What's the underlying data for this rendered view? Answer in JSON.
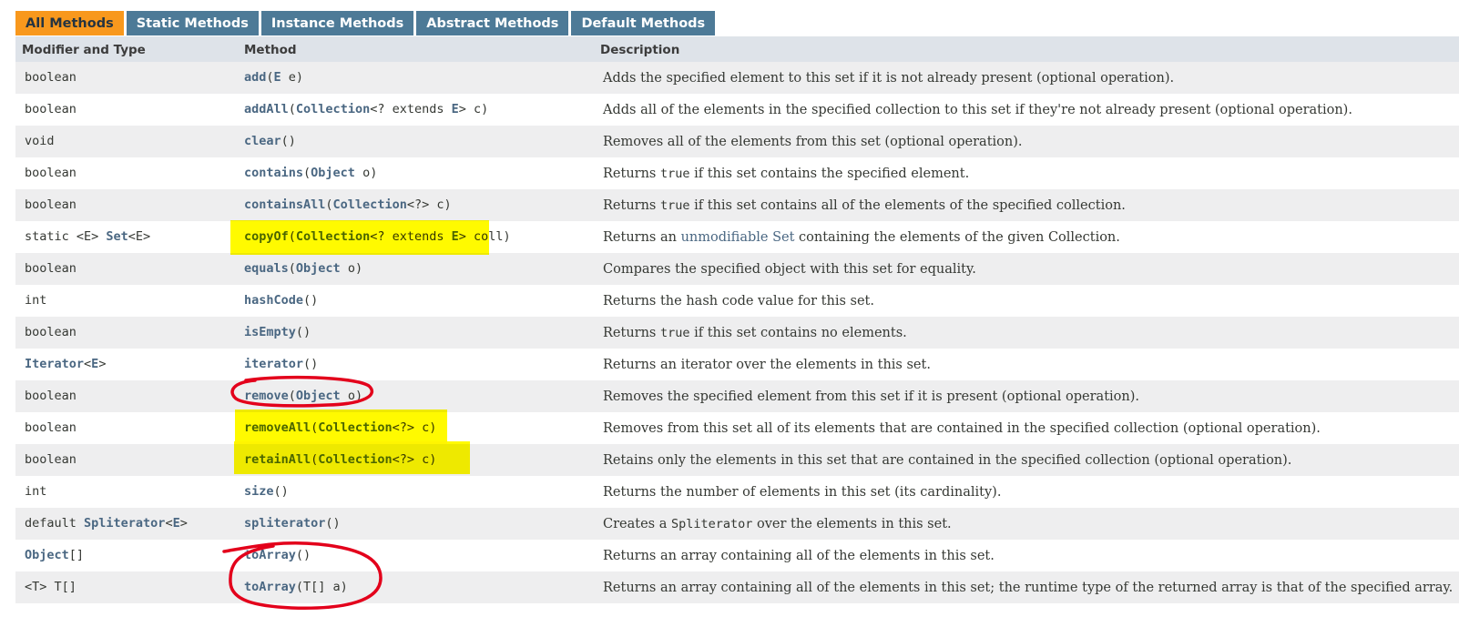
{
  "tabs": [
    "All Methods",
    "Static Methods",
    "Instance Methods",
    "Abstract Methods",
    "Default Methods"
  ],
  "header": {
    "modifier": "Modifier and Type",
    "method": "Method",
    "description": "Description"
  },
  "rows": [
    {
      "type": [
        {
          "t": "boolean"
        }
      ],
      "method": [
        {
          "t": "add",
          "l": 1
        },
        {
          "t": "("
        },
        {
          "t": "E",
          "l": 1
        },
        {
          "t": " e)"
        }
      ],
      "desc": [
        {
          "t": "Adds the specified element to this set if it is not already present (optional operation)."
        }
      ]
    },
    {
      "type": [
        {
          "t": "boolean"
        }
      ],
      "method": [
        {
          "t": "addAll",
          "l": 1
        },
        {
          "t": "("
        },
        {
          "t": "Collection",
          "l": 1
        },
        {
          "t": "<? extends "
        },
        {
          "t": "E",
          "l": 1
        },
        {
          "t": "> c)"
        }
      ],
      "desc": [
        {
          "t": "Adds all of the elements in the specified collection to this set if they're not already present (optional operation)."
        }
      ]
    },
    {
      "type": [
        {
          "t": "void"
        }
      ],
      "method": [
        {
          "t": "clear",
          "l": 1
        },
        {
          "t": "()"
        }
      ],
      "desc": [
        {
          "t": "Removes all of the elements from this set (optional operation)."
        }
      ]
    },
    {
      "type": [
        {
          "t": "boolean"
        }
      ],
      "method": [
        {
          "t": "contains",
          "l": 1
        },
        {
          "t": "("
        },
        {
          "t": "Object",
          "l": 1
        },
        {
          "t": " o)"
        }
      ],
      "desc": [
        {
          "t": "Returns "
        },
        {
          "t": "true",
          "m": 1
        },
        {
          "t": " if this set contains the specified element."
        }
      ]
    },
    {
      "type": [
        {
          "t": "boolean"
        }
      ],
      "method": [
        {
          "t": "containsAll",
          "l": 1
        },
        {
          "t": "("
        },
        {
          "t": "Collection",
          "l": 1
        },
        {
          "t": "<?> c)"
        }
      ],
      "desc": [
        {
          "t": "Returns "
        },
        {
          "t": "true",
          "m": 1
        },
        {
          "t": " if this set contains all of the elements of the specified collection."
        }
      ]
    },
    {
      "type": [
        {
          "t": "static <E> "
        },
        {
          "t": "Set",
          "l": 1
        },
        {
          "t": "<E>"
        }
      ],
      "method": [
        {
          "t": "copyOf",
          "l": 1
        },
        {
          "t": "("
        },
        {
          "t": "Collection",
          "l": 1
        },
        {
          "t": "<? extends "
        },
        {
          "t": "E",
          "l": 1
        },
        {
          "t": "> coll)"
        }
      ],
      "desc": [
        {
          "t": "Returns an "
        },
        {
          "t": "unmodifiable Set",
          "p": 1
        },
        {
          "t": " containing the elements of the given Collection."
        }
      ]
    },
    {
      "type": [
        {
          "t": "boolean"
        }
      ],
      "method": [
        {
          "t": "equals",
          "l": 1
        },
        {
          "t": "("
        },
        {
          "t": "Object",
          "l": 1
        },
        {
          "t": " o)"
        }
      ],
      "desc": [
        {
          "t": "Compares the specified object with this set for equality."
        }
      ]
    },
    {
      "type": [
        {
          "t": "int"
        }
      ],
      "method": [
        {
          "t": "hashCode",
          "l": 1
        },
        {
          "t": "()"
        }
      ],
      "desc": [
        {
          "t": "Returns the hash code value for this set."
        }
      ]
    },
    {
      "type": [
        {
          "t": "boolean"
        }
      ],
      "method": [
        {
          "t": "isEmpty",
          "l": 1
        },
        {
          "t": "()"
        }
      ],
      "desc": [
        {
          "t": "Returns "
        },
        {
          "t": "true",
          "m": 1
        },
        {
          "t": " if this set contains no elements."
        }
      ]
    },
    {
      "type": [
        {
          "t": "Iterator",
          "l": 1
        },
        {
          "t": "<"
        },
        {
          "t": "E",
          "l": 1
        },
        {
          "t": ">"
        }
      ],
      "method": [
        {
          "t": "iterator",
          "l": 1
        },
        {
          "t": "()"
        }
      ],
      "desc": [
        {
          "t": "Returns an iterator over the elements in this set."
        }
      ]
    },
    {
      "type": [
        {
          "t": "boolean"
        }
      ],
      "method": [
        {
          "t": "remove",
          "l": 1
        },
        {
          "t": "("
        },
        {
          "t": "Object",
          "l": 1
        },
        {
          "t": " o)"
        }
      ],
      "desc": [
        {
          "t": "Removes the specified element from this set if it is present (optional operation)."
        }
      ]
    },
    {
      "type": [
        {
          "t": "boolean"
        }
      ],
      "method": [
        {
          "t": "removeAll",
          "l": 1
        },
        {
          "t": "("
        },
        {
          "t": "Collection",
          "l": 1
        },
        {
          "t": "<?> c)"
        }
      ],
      "desc": [
        {
          "t": "Removes from this set all of its elements that are contained in the specified collection (optional operation)."
        }
      ]
    },
    {
      "type": [
        {
          "t": "boolean"
        }
      ],
      "method": [
        {
          "t": "retainAll",
          "l": 1
        },
        {
          "t": "("
        },
        {
          "t": "Collection",
          "l": 1
        },
        {
          "t": "<?> c)"
        }
      ],
      "desc": [
        {
          "t": "Retains only the elements in this set that are contained in the specified collection (optional operation)."
        }
      ]
    },
    {
      "type": [
        {
          "t": "int"
        }
      ],
      "method": [
        {
          "t": "size",
          "l": 1
        },
        {
          "t": "()"
        }
      ],
      "desc": [
        {
          "t": "Returns the number of elements in this set (its cardinality)."
        }
      ]
    },
    {
      "type": [
        {
          "t": "default "
        },
        {
          "t": "Spliterator",
          "l": 1
        },
        {
          "t": "<"
        },
        {
          "t": "E",
          "l": 1
        },
        {
          "t": ">"
        }
      ],
      "method": [
        {
          "t": "spliterator",
          "l": 1
        },
        {
          "t": "()"
        }
      ],
      "desc": [
        {
          "t": "Creates a "
        },
        {
          "t": "Spliterator",
          "m": 1
        },
        {
          "t": " over the elements in this set."
        }
      ]
    },
    {
      "type": [
        {
          "t": "Object",
          "l": 1
        },
        {
          "t": "[]"
        }
      ],
      "method": [
        {
          "t": "toArray",
          "l": 1
        },
        {
          "t": "()"
        }
      ],
      "desc": [
        {
          "t": "Returns an array containing all of the elements in this set."
        }
      ]
    },
    {
      "type": [
        {
          "t": "<T> T[]"
        }
      ],
      "method": [
        {
          "t": "toArray",
          "l": 1
        },
        {
          "t": "(T[] a)"
        }
      ],
      "desc": [
        {
          "t": "Returns an array containing all of the elements in this set; the runtime type of the returned array is that of the specified array."
        }
      ]
    }
  ],
  "colors": {
    "highlight": "#fffa00",
    "annotation": "#e3001b",
    "link": "#4a6782",
    "active_tab": "#f8981d",
    "tab": "#4d7a97",
    "header_bg": "#dee3e9",
    "odd_row": "#eeeeef"
  }
}
